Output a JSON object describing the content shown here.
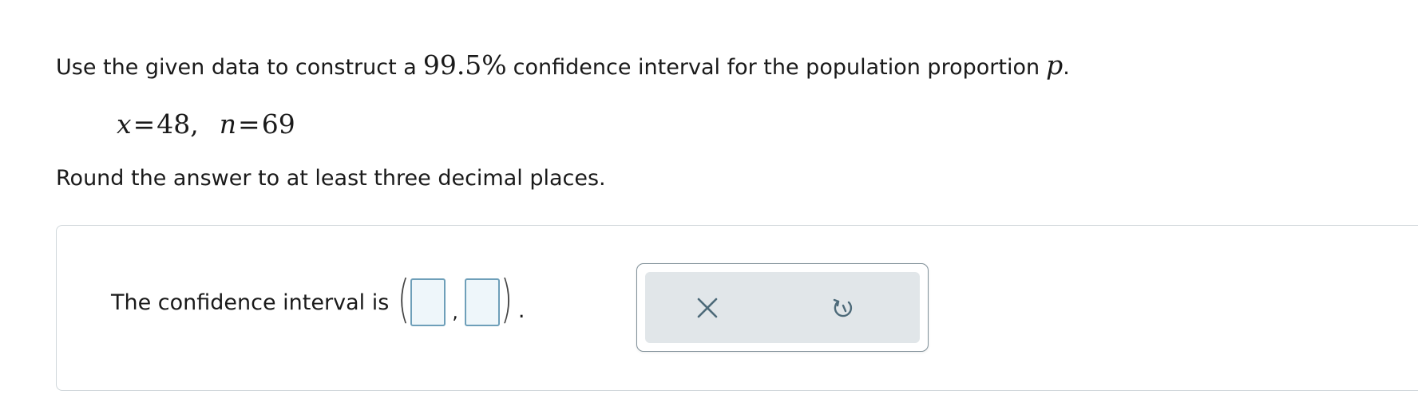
{
  "question": {
    "prompt_before": "Use the given data to construct a",
    "confidence_level": "99.5%",
    "prompt_after": "confidence interval for the population proportion",
    "parameter_symbol": "p",
    "prompt_end": ".",
    "given": {
      "x_label": "x",
      "x_value": "48",
      "n_label": "n",
      "n_value": "69",
      "equals": "=",
      "separator": ","
    },
    "rounding_instruction": "Round the answer to at least three decimal places."
  },
  "answer": {
    "label": "The confidence interval is",
    "lower_bound_value": "",
    "upper_bound_value": "",
    "separator": ",",
    "end": "."
  },
  "tools": {
    "clear_icon": "x-icon",
    "undo_icon": "undo-icon",
    "icon_color": "#4d6a79"
  },
  "colors": {
    "input_fill": "#eef6fa",
    "input_border": "#6e9fb9",
    "toolbar_fill": "#e1e6e9"
  }
}
